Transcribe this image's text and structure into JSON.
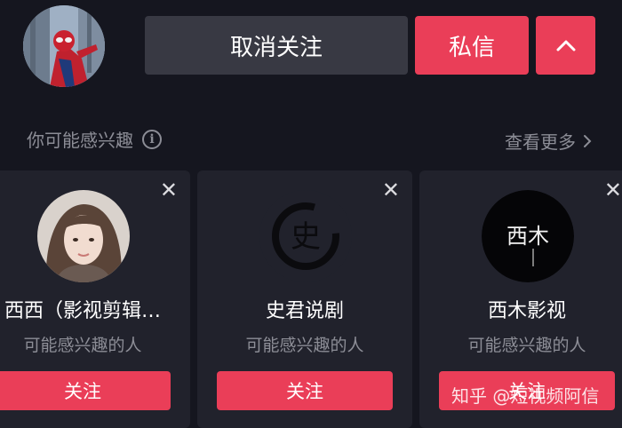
{
  "profile": {
    "unfollow_label": "取消关注",
    "message_label": "私信",
    "expand_icon": "chevron-up-icon"
  },
  "suggestions": {
    "title": "你可能感兴趣",
    "see_more": "查看更多",
    "cards": [
      {
        "name": "西西（影视剪辑…",
        "subtitle": "可能感兴趣的人",
        "follow_label": "关注"
      },
      {
        "name": "史君说剧",
        "subtitle": "可能感兴趣的人",
        "follow_label": "关注",
        "avatar_text": "史"
      },
      {
        "name": "西木影视",
        "subtitle": "可能感兴趣的人",
        "follow_label": "关注",
        "avatar_text": "西木"
      }
    ]
  },
  "watermark": "知乎 @短视频阿信",
  "colors": {
    "background": "#15161f",
    "card": "#21222c",
    "accent": "#ea3e58",
    "secondary_button": "#383943",
    "muted_text": "#8c8d96"
  }
}
